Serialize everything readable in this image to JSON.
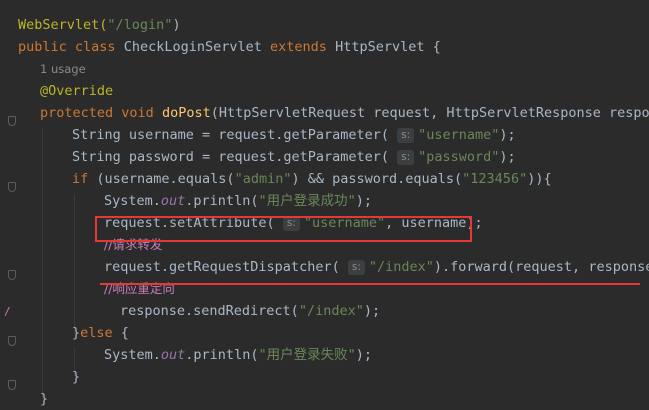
{
  "editor": {
    "lines": {
      "l1": {
        "annotation": "WebServlet(",
        "arg": "\"/login\"",
        "close": ")"
      },
      "l2": {
        "kw_public": "public",
        "kw_class": "class",
        "name": "CheckLoginServlet",
        "kw_extends": "extends",
        "parent": "HttpServlet",
        "brace": "{"
      },
      "l3": {
        "usage": "1 usage"
      },
      "l4": {
        "annotation": "@Override"
      },
      "l5": {
        "kw_protected": "protected",
        "kw_void": "void",
        "method": "doPost",
        "params": "(HttpServletRequest request, HttpServletResponse respon"
      },
      "l6": {
        "pre": "String username = request.getParameter(",
        "hint": "s:",
        "str": "\"username\"",
        "post": ");"
      },
      "l7": {
        "pre": "String password = request.getParameter(",
        "hint": "s:",
        "str": "\"password\"",
        "post": ");"
      },
      "l8": {
        "kw_if": "if",
        "a": " (username.equals(",
        "s1": "\"admin\"",
        "b": ") && password.equals(",
        "s2": "\"123456\"",
        "c": ")){"
      },
      "l9": {
        "pre": "System.",
        "field": "out",
        "mid": ".println(",
        "str": "\"用户登录成功\"",
        "post": ");"
      },
      "l10": {
        "pre": "request.setAttribute(",
        "hint": "s:",
        "str": "\"username\"",
        "post": ", username);"
      },
      "l11": {
        "comment": "//请求转发"
      },
      "l12": {
        "pre": "request.getRequestDispatcher(",
        "hint": "s:",
        "str": "\"/index\"",
        "post": ").forward(request, response)"
      },
      "l13": {
        "comment": "//响应重定向"
      },
      "l14": {
        "pre": "response.sendRedirect(",
        "str": "\"/index\"",
        "post": ");"
      },
      "l15": {
        "close": "}",
        "kw_else": "else",
        "open": " {"
      },
      "l16": {
        "pre": "System.",
        "field": "out",
        "mid": ".println(",
        "str": "\"用户登录失败\"",
        "post": ");"
      },
      "l17": {
        "brace": "}"
      },
      "l18": {
        "brace": "}"
      }
    },
    "colors": {
      "background": "#2b2b2b",
      "keyword": "#cc7832",
      "string": "#6a8759",
      "method": "#ffc66d",
      "annotation": "#bbb529",
      "comment": "#c77dbb",
      "highlight": "#e53935"
    }
  }
}
